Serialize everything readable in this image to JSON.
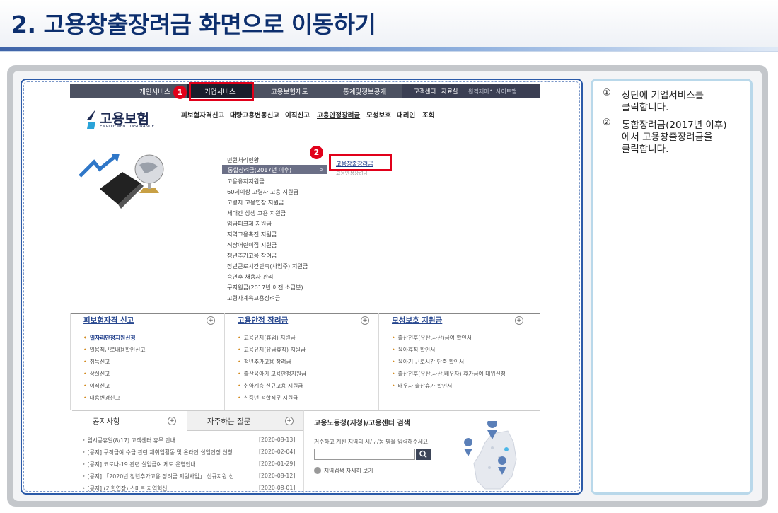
{
  "slide": {
    "title": "2. 고용창출장려금 화면으로 이동하기"
  },
  "topnav": {
    "items": [
      "개인서비스",
      "기업서비스",
      "고용보험제도",
      "통계및정보공개"
    ],
    "utility": [
      "고객센터",
      "자료실",
      "원격제어",
      "사이트맵"
    ]
  },
  "badges": [
    "1",
    "2"
  ],
  "logo": {
    "text": "고용보험",
    "sub": "EMPLOYMENT INSURANCE"
  },
  "main_menu": [
    "피보험자격신고",
    "대량고용변동신고",
    "이직신고",
    "고용안정장려금",
    "모성보호",
    "대리인",
    "조회"
  ],
  "submenu": [
    "민원처리현황",
    "통합장려금(2017년 이후)",
    "고용유지지원금",
    "60세이상 고령자 고용 지원금",
    "고령자 고용연장 지원금",
    "세대간 상생 고용 지원금",
    "임금피크제 지원금",
    "지역고용촉진 지원금",
    "직장어린이집 지원금",
    "청년추가고용 장려금",
    "장년근로시간단축(사업주) 지원금",
    "승인후 채용자 관리",
    "구지원금(2017년 이전 소급분)",
    "고령자계속고용장려금"
  ],
  "submenu_arrow": ">",
  "submenu2": [
    "고용창출장려금",
    "고용안정장려금"
  ],
  "panels": [
    {
      "title": "피보험자격 신고",
      "items": [
        "일자리안정지원신청",
        "일용직근로내용확인신고",
        "취득신고",
        "상실신고",
        "이직신고",
        "내용변경신고"
      ]
    },
    {
      "title": "고용안정 장려금",
      "items": [
        "고용유지(휴업) 지원금",
        "고용유지(유급휴직) 지원금",
        "청년추가고용 장려금",
        "출산육아기 고용안정지원금",
        "취약계층 신규고용 지원금",
        "신중년 적합직무 지원금"
      ]
    },
    {
      "title": "모성보호 지원금",
      "items": [
        "출산전후(유산,사산)급여 확인서",
        "육아휴직 확인서",
        "육아기 근로시간 단축 확인서",
        "출산전후(유산,사산,배우자) 휴가급여 대위신청",
        "배우자 출산휴가 확인서"
      ]
    }
  ],
  "plus": "+",
  "notice": {
    "tabs": [
      "공지사항",
      "자주하는 질문"
    ],
    "rows": [
      {
        "title": "임시공휴일(8/17) 고객센터 휴무 안내",
        "date": "[2020-08-13]"
      },
      {
        "title": "[공지] 구직급여 수급 관련 재취업활동 및 온라인 실업인정 신청...",
        "date": "[2020-02-04]"
      },
      {
        "title": "[공지] 코로나-19 관련 실업급여 제도 운영안내",
        "date": "[2020-01-29]"
      },
      {
        "title": "[공지] 「2020년 청년추가고용 장려금 지원사업」 신규지원 신...",
        "date": "[2020-08-12]"
      },
      {
        "title": "[공지] (기한연장) 스마트 지역혁신 ..",
        "date": "[2020-08-01]"
      }
    ]
  },
  "search": {
    "title": "고용노동청(지청)/고용센터 검색",
    "hint": "거주하고 계신 지역의 시/구/동 명을 입력해주세요.",
    "more": "지역검색 자세히 보기"
  },
  "notes": {
    "n1": "①",
    "n1_line1": "상단에 기업서비스를",
    "n1_line2": "클릭합니다.",
    "n2": "②",
    "n2_line1": "통합장려금(2017년 이후)",
    "n2_line2": "에서 고용창출장려금을",
    "n2_line3": "클릭합니다."
  },
  "colors": {
    "accent_red": "#e1001a",
    "title_navy": "#0d2f6e",
    "nav_dark": "#4c5161"
  }
}
